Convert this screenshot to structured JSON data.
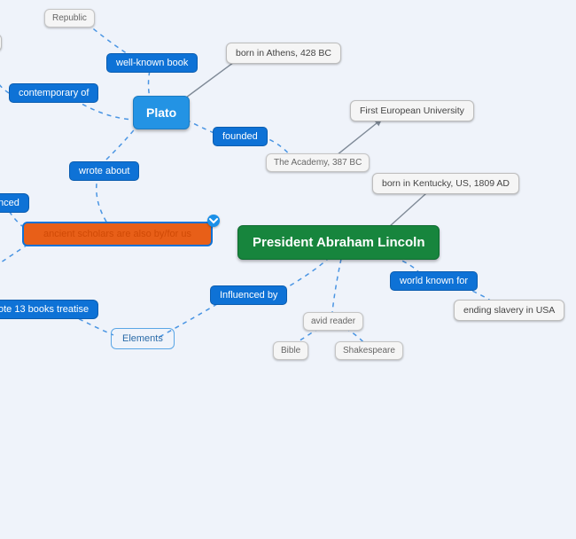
{
  "nodes": {
    "lincoln": {
      "label": "President Abraham Lincoln"
    },
    "plato": {
      "label": "Plato"
    },
    "republic": {
      "label": "Republic"
    },
    "well_known": {
      "label": "well-known book"
    },
    "contemporary": {
      "label": "contemporary of"
    },
    "wrote_about": {
      "label": "wrote about"
    },
    "founded": {
      "label": "founded"
    },
    "born_athens": {
      "label": "born in Athens, 428 BC"
    },
    "first_uni": {
      "label": "First European University"
    },
    "academy": {
      "label": "The Academy, 387 BC"
    },
    "selected": {
      "label": "ancient scholars are also by/for us"
    },
    "nced": {
      "label": "nced"
    },
    "treatise": {
      "label": "ote 13 books treatise"
    },
    "elements": {
      "label": "Elements"
    },
    "influenced_by": {
      "label": "Influenced by"
    },
    "born_kentucky": {
      "label": "born in Kentucky, US, 1809 AD"
    },
    "world_known": {
      "label": "world known for"
    },
    "end_slavery": {
      "label": "ending slavery in USA"
    },
    "avid_reader": {
      "label": "avid reader"
    },
    "bible": {
      "label": "Bible"
    },
    "shakespeare": {
      "label": "Shakespeare"
    }
  }
}
